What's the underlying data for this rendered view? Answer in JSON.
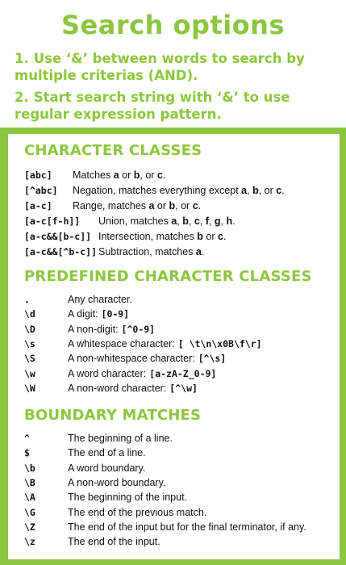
{
  "header": {
    "title": "Search options",
    "tips": [
      {
        "num": "1.",
        "text": "Use ‘&’ between words to search by multiple criterias (AND)."
      },
      {
        "num": "2.",
        "text": "Start search string with ‘&’ to use regular expression pattern."
      }
    ]
  },
  "sections": {
    "character_classes": {
      "title": "CHARACTER CLASSES",
      "rows": [
        {
          "code": "[abc]",
          "desc": [
            "Matches ",
            "a",
            " or ",
            "b",
            ", or ",
            "c",
            "."
          ]
        },
        {
          "code": "[^abc]",
          "desc": [
            "Negation, matches everything except ",
            "a",
            ", ",
            "b",
            ", or ",
            "c",
            "."
          ]
        },
        {
          "code": "[a-c]",
          "desc": [
            "Range, matches ",
            "a",
            " or ",
            "b",
            ", or ",
            "c",
            "."
          ]
        },
        {
          "code": "[a-c[f-h]]",
          "desc": [
            "Union, matches ",
            "a",
            ", ",
            "b",
            ", ",
            "c",
            ", ",
            "f",
            ", ",
            "g",
            ", ",
            "h",
            "."
          ]
        },
        {
          "code": "[a-c&&[b-c]]",
          "desc": [
            "Intersection, matches ",
            "b",
            " or ",
            "c",
            "."
          ]
        },
        {
          "code": "[a-c&&[^b-c]]",
          "desc": [
            "Subtraction, matches ",
            "a",
            "."
          ]
        }
      ]
    },
    "predefined": {
      "title": "PREDEFINED CHARACTER CLASSES",
      "rows": [
        {
          "code": ".",
          "desc": "Any character.",
          "extra": ""
        },
        {
          "code": "\\d",
          "desc": "A digit:",
          "extra": "[0-9]"
        },
        {
          "code": "\\D",
          "desc": "A non-digit:",
          "extra": "[^0-9]"
        },
        {
          "code": "\\s",
          "desc": "A whitespace character:",
          "extra": "[ \\t\\n\\x0B\\f\\r]"
        },
        {
          "code": "\\S",
          "desc": "A non-whitespace character:",
          "extra": "[^\\s]"
        },
        {
          "code": "\\w",
          "desc": "A word character:",
          "extra": "[a-zA-Z_0-9]"
        },
        {
          "code": "\\W",
          "desc": "A non-word character:",
          "extra": "[^\\w]"
        }
      ]
    },
    "boundary": {
      "title": "BOUNDARY MATCHES",
      "rows": [
        {
          "code": "^",
          "desc": "The beginning of a line."
        },
        {
          "code": "$",
          "desc": "The end of a line."
        },
        {
          "code": "\\b",
          "desc": "A word boundary."
        },
        {
          "code": "\\B",
          "desc": "A non-word boundary."
        },
        {
          "code": "\\A",
          "desc": "The beginning of the input."
        },
        {
          "code": "\\G",
          "desc": "The end of the previous match."
        },
        {
          "code": "\\Z",
          "desc": "The end of the input but for the final terminator, if any."
        },
        {
          "code": "\\z",
          "desc": "The end of the input."
        }
      ]
    }
  },
  "colors": {
    "brand_green": "#8cc63f",
    "text": "#111111",
    "panel": "#ffffff"
  }
}
